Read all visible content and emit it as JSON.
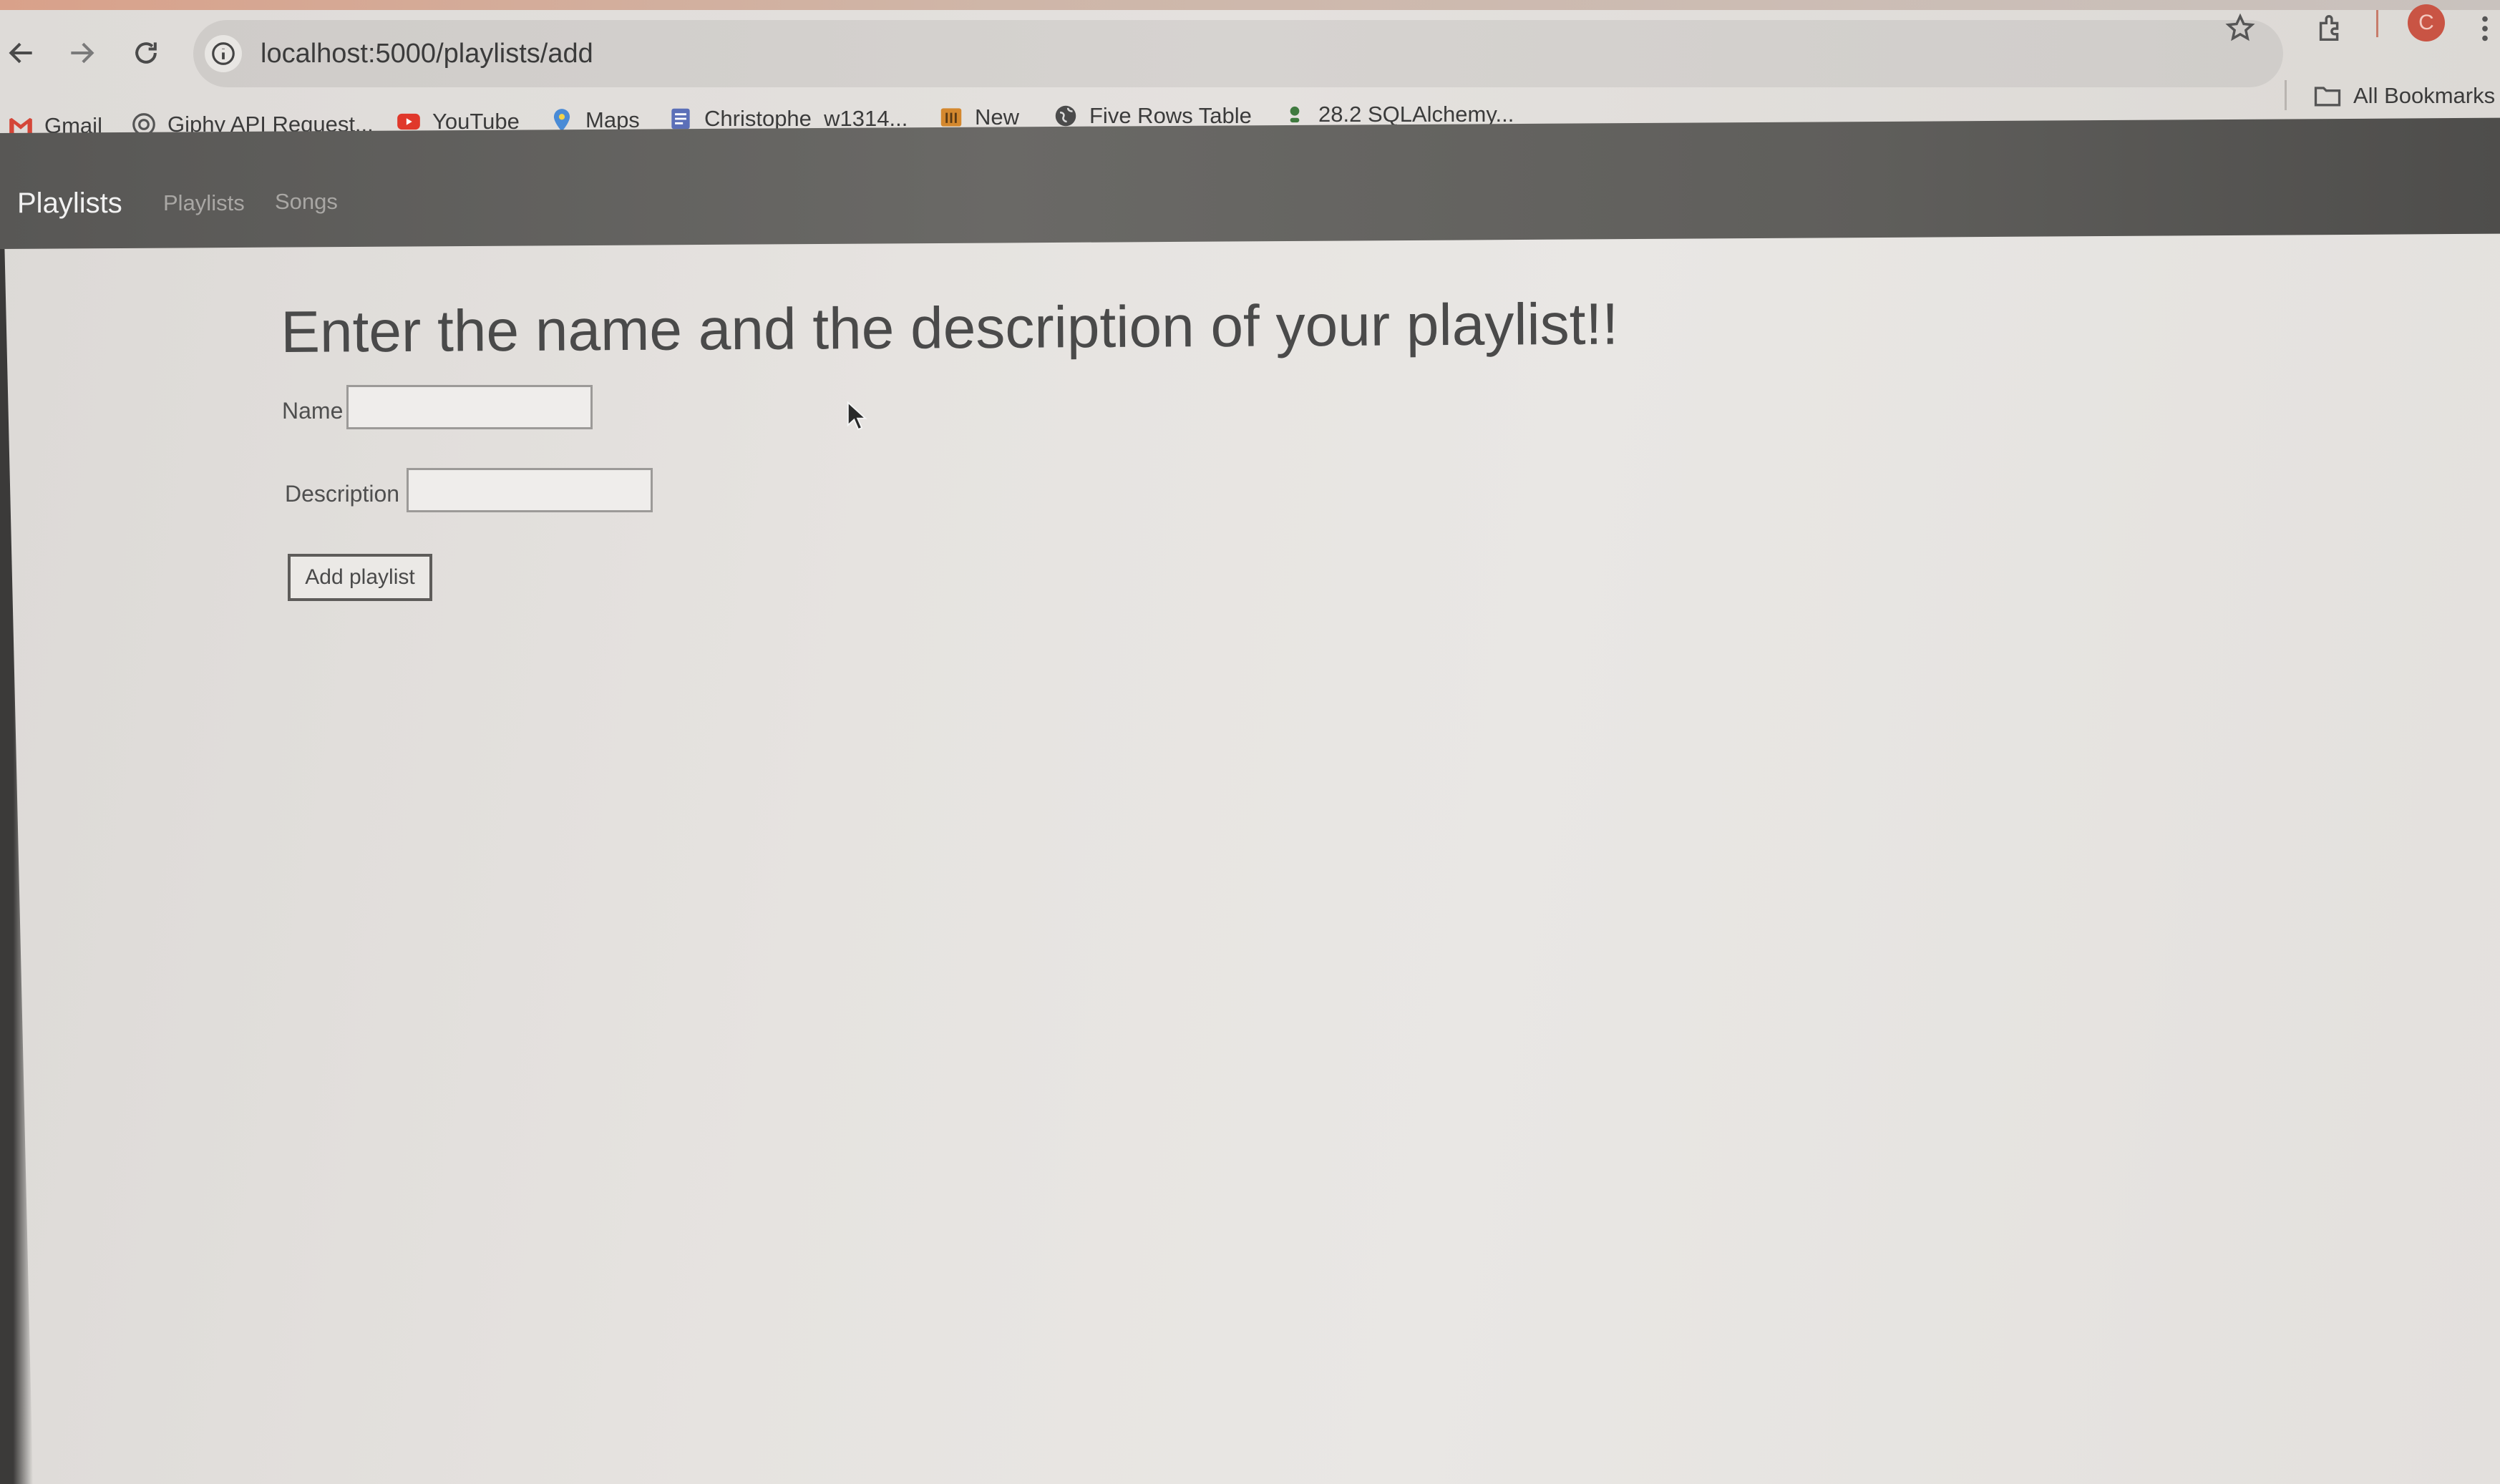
{
  "browser": {
    "url": "localhost:5000/playlists/add",
    "profile_initial": "C",
    "bookmarks": [
      {
        "label": "Gmail",
        "icon": "gmail-icon"
      },
      {
        "label": "Giphy API Request...",
        "icon": "openai-icon"
      },
      {
        "label": "YouTube",
        "icon": "youtube-icon"
      },
      {
        "label": "Maps",
        "icon": "maps-pin-icon"
      },
      {
        "label": "Christophe_w1314...",
        "icon": "document-icon"
      },
      {
        "label": "New",
        "icon": "notebook-icon"
      },
      {
        "label": "Five Rows Table",
        "icon": "globe-icon"
      },
      {
        "label": "28.2 SQLAlchemy...",
        "icon": "user-dot-icon"
      }
    ],
    "all_bookmarks": "All Bookmarks"
  },
  "navbar": {
    "brand": "Playlists",
    "links": [
      "Playlists",
      "Songs"
    ]
  },
  "page": {
    "heading": "Enter the name and the description of your playlist!!",
    "form": {
      "name_label": "Name",
      "name_value": "",
      "description_label": "Description",
      "description_value": "",
      "submit_label": "Add playlist"
    }
  },
  "colors": {
    "navbar": "#626160",
    "brand_text": "#f2f2f2",
    "nav_link_text": "#a9a7a4",
    "youtube_red": "#e0382b",
    "profile_red": "#c95444"
  }
}
